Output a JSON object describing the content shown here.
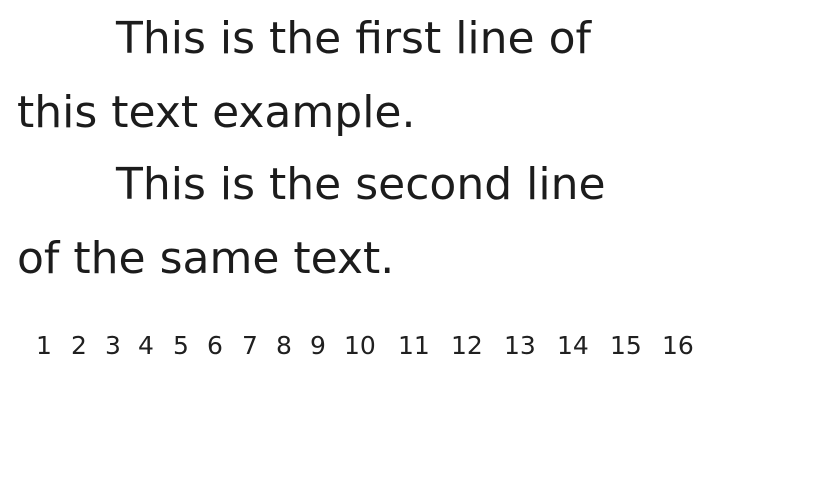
{
  "document": {
    "lines": [
      "This is the first line of",
      "this text example.",
      "This is the second line",
      "of the same text."
    ],
    "ruler_numbers": [
      "1",
      "2",
      "3",
      "4",
      "5",
      "6",
      "7",
      "8",
      "9",
      "10",
      "11",
      "12",
      "13",
      "14",
      "15",
      "16"
    ]
  }
}
